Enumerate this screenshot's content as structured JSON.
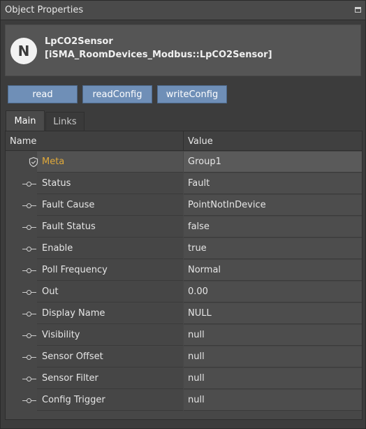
{
  "panel": {
    "title": "Object Properties"
  },
  "object": {
    "logo_letter": "N",
    "name": "LpCO2Sensor",
    "type": "[iSMA_RoomDevices_Modbus::LpCO2Sensor]"
  },
  "toolbar": {
    "read": "read",
    "read_config": "readConfig",
    "write_config": "writeConfig"
  },
  "tabs": {
    "main": "Main",
    "links": "Links"
  },
  "table": {
    "headers": {
      "name": "Name",
      "value": "Value"
    },
    "rows": [
      {
        "name": "Meta",
        "value": "Group1",
        "icon": "shield-icon"
      },
      {
        "name": "Status",
        "value": "Fault",
        "icon": "slot-icon"
      },
      {
        "name": "Fault Cause",
        "value": "PointNotInDevice",
        "icon": "slot-icon"
      },
      {
        "name": "Fault Status",
        "value": "false",
        "icon": "slot-icon"
      },
      {
        "name": "Enable",
        "value": "true",
        "icon": "slot-icon"
      },
      {
        "name": "Poll Frequency",
        "value": "Normal",
        "icon": "slot-icon"
      },
      {
        "name": "Out",
        "value": "0.00",
        "icon": "slot-icon"
      },
      {
        "name": "Display Name",
        "value": "NULL",
        "icon": "slot-icon"
      },
      {
        "name": "Visibility",
        "value": "null",
        "icon": "slot-icon"
      },
      {
        "name": "Sensor Offset",
        "value": "null",
        "icon": "slot-icon"
      },
      {
        "name": "Sensor Filter",
        "value": "null",
        "icon": "slot-icon"
      },
      {
        "name": "Config Trigger",
        "value": "null",
        "icon": "slot-icon"
      }
    ]
  },
  "colors": {
    "accent_button": "#6f8fb7",
    "meta_label": "#e0a93a",
    "background": "#3c3c3c"
  }
}
